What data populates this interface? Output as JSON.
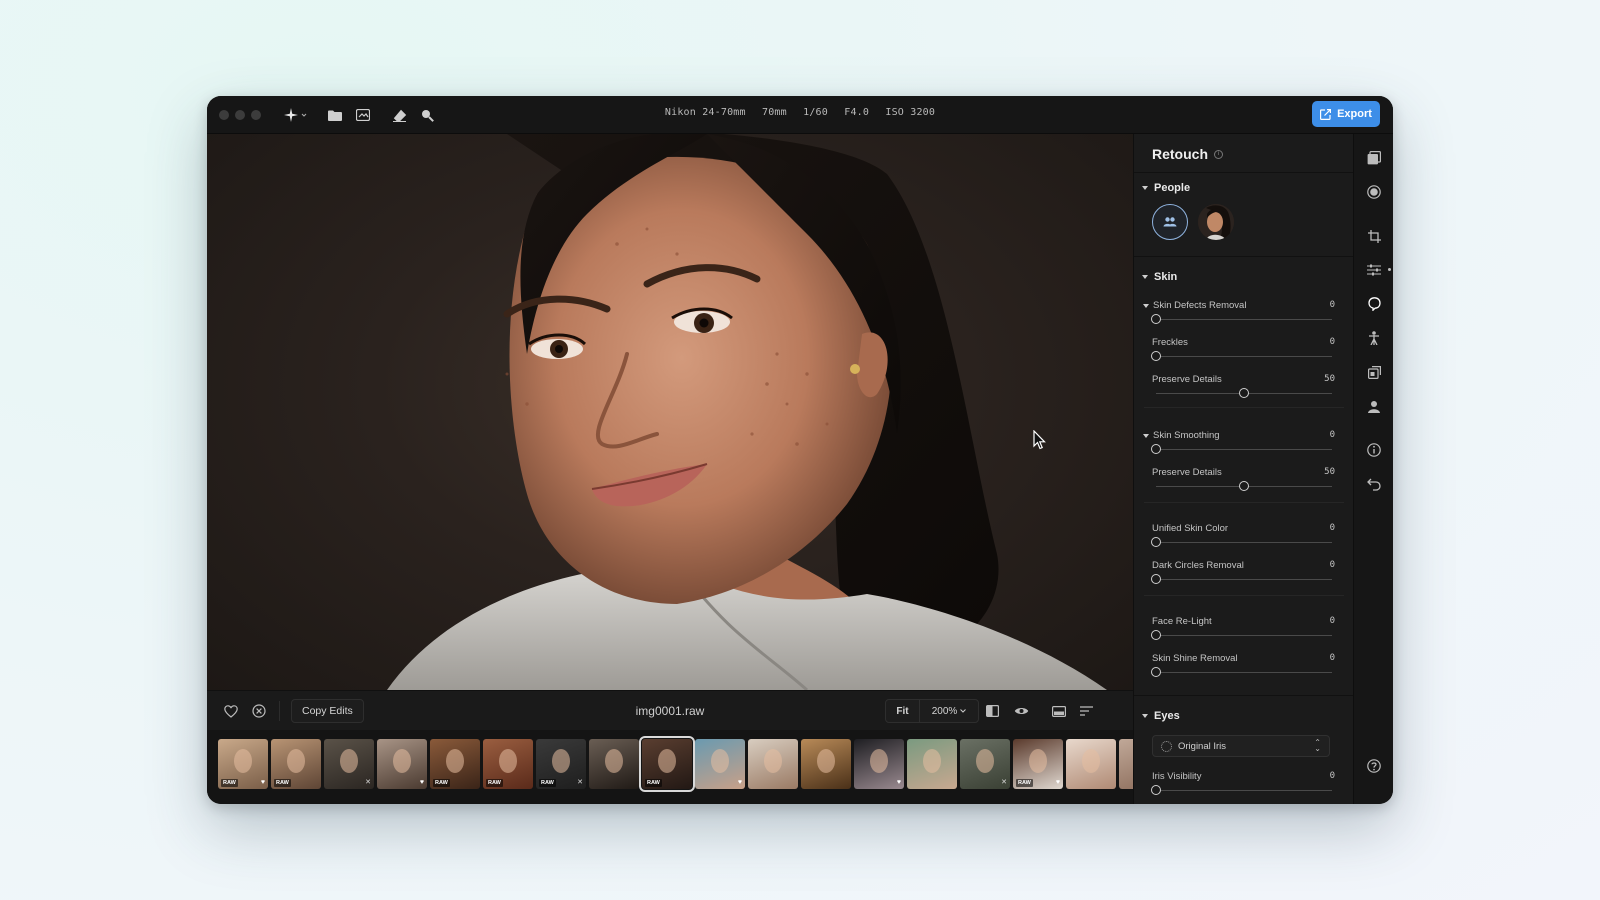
{
  "topbar": {
    "meta": [
      "Nikon 24-70mm",
      "70mm",
      "1/60",
      "F4.0",
      "ISO 3200"
    ],
    "export_label": "Export"
  },
  "bottombar": {
    "copy_edits_label": "Copy Edits",
    "filename": "img0001.raw",
    "fit_label": "Fit",
    "zoom_label": "200%"
  },
  "filmstrip": {
    "thumbs": [
      {
        "badge": "RAW",
        "mark": "heart",
        "colors": [
          "#c9a98a",
          "#7a5e48"
        ]
      },
      {
        "badge": "RAW",
        "mark": "",
        "colors": [
          "#b89474",
          "#5e4535"
        ]
      },
      {
        "badge": "",
        "mark": "x",
        "colors": [
          "#5a5248",
          "#2b2622"
        ]
      },
      {
        "badge": "",
        "mark": "heart",
        "colors": [
          "#a89486",
          "#4a3a30"
        ]
      },
      {
        "badge": "RAW",
        "mark": "",
        "colors": [
          "#8a5a3a",
          "#3a2418"
        ]
      },
      {
        "badge": "RAW",
        "mark": "",
        "colors": [
          "#9a5e40",
          "#5a2a1a"
        ]
      },
      {
        "badge": "RAW",
        "mark": "x",
        "colors": [
          "#3a3a3a",
          "#1e1e1e"
        ]
      },
      {
        "badge": "",
        "mark": "",
        "colors": [
          "#6a5e54",
          "#201a16"
        ]
      },
      {
        "badge": "RAW",
        "mark": "",
        "colors": [
          "#5a3e30",
          "#221814"
        ]
      },
      {
        "badge": "",
        "mark": "heart",
        "colors": [
          "#6a9ab0",
          "#c8a088"
        ]
      },
      {
        "badge": "",
        "mark": "",
        "colors": [
          "#d8cdc0",
          "#9a7a64"
        ]
      },
      {
        "badge": "",
        "mark": "",
        "colors": [
          "#b88a58",
          "#4a3018"
        ]
      },
      {
        "badge": "",
        "mark": "heart",
        "colors": [
          "#1e1e22",
          "#9a8a90"
        ]
      },
      {
        "badge": "",
        "mark": "",
        "colors": [
          "#7a9a80",
          "#c8a890"
        ]
      },
      {
        "badge": "",
        "mark": "x",
        "colors": [
          "#6a7064",
          "#3a4034"
        ]
      },
      {
        "badge": "RAW",
        "mark": "heart",
        "colors": [
          "#5a3a2c",
          "#e0d8d0"
        ]
      },
      {
        "badge": "",
        "mark": "",
        "colors": [
          "#e8d8cc",
          "#b08a74"
        ]
      },
      {
        "badge": "",
        "mark": "",
        "colors": [
          "#c0a898",
          "#8a6a58"
        ]
      }
    ],
    "selected_index": 8
  },
  "panel": {
    "title": "Retouch",
    "people_header": "People",
    "skin_header": "Skin",
    "eyes_header": "Eyes",
    "sliders": [
      {
        "label": "Skin Defects Removal",
        "value": "0",
        "level": 0,
        "caret": true
      },
      {
        "label": "Freckles",
        "value": "0",
        "level": 0,
        "caret": false
      },
      {
        "label": "Preserve Details",
        "value": "50",
        "level": 0.5,
        "caret": false
      },
      {
        "label": "Skin Smoothing",
        "value": "0",
        "level": 0,
        "caret": true
      },
      {
        "label": "Preserve Details",
        "value": "50",
        "level": 0.5,
        "caret": false
      },
      {
        "label": "Unified Skin Color",
        "value": "0",
        "level": 0,
        "caret": false
      },
      {
        "label": "Dark Circles Removal",
        "value": "0",
        "level": 0,
        "caret": false
      },
      {
        "label": "Face Re-Light",
        "value": "0",
        "level": 0,
        "caret": false
      },
      {
        "label": "Skin Shine Removal",
        "value": "0",
        "level": 0,
        "caret": false
      }
    ],
    "iris_select": "Original Iris",
    "iris_visibility": {
      "label": "Iris Visibility",
      "value": "0",
      "level": 0
    }
  },
  "colors": {
    "accent": "#3d8ee8",
    "window_bg": "#161616",
    "panel_bg": "#1b1b1b"
  }
}
